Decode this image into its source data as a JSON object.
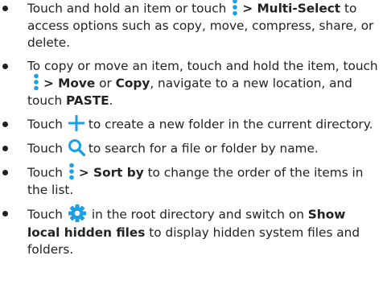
{
  "colors": {
    "accent": "#1aa0e6",
    "text": "#222222"
  },
  "icons": [
    "more-vertical-icon",
    "plus-icon",
    "search-icon",
    "gear-icon"
  ],
  "items": [
    {
      "p1": "Touch and hold an item or touch",
      "p2": "> Multi-Select",
      "p3": "to access options such as copy, move, compress, share, or delete."
    },
    {
      "p1": "To copy or move an item, touch and hold the item, touch",
      "p2": "> Move",
      "p3": "or",
      "p4": "Copy",
      "p5": ", navigate to a new location, and touch",
      "p6": "PASTE",
      "p7": "."
    },
    {
      "p1": "Touch",
      "p2": "to create a new folder in the current directory."
    },
    {
      "p1": "Touch",
      "p2": "to search for a file or folder by name."
    },
    {
      "p1": "Touch",
      "p2": "> Sort by",
      "p3": "to change the order of the items in the list."
    },
    {
      "p1": "Touch",
      "p2": "in the root directory and switch on",
      "p3": "Show local hidden files",
      "p4": "to display hidden system files and folders."
    }
  ]
}
